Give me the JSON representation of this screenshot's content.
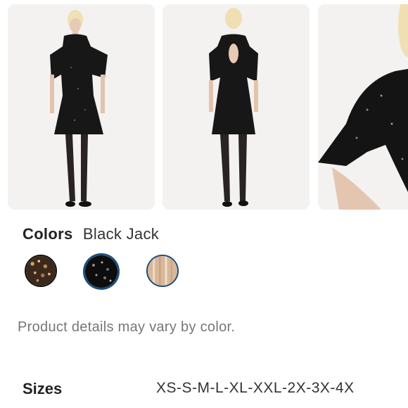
{
  "gallery": {
    "images": [
      {
        "icon": "dress-front-photo"
      },
      {
        "icon": "dress-back-photo"
      },
      {
        "icon": "dress-sleeve-closeup-photo"
      }
    ]
  },
  "colors": {
    "label": "Colors",
    "selected": "Black Jack",
    "swatches": [
      {
        "icon": "gold-sequin-swatch",
        "color": "#6b4a2e",
        "selected": false
      },
      {
        "icon": "black-sequin-swatch",
        "color": "#111111",
        "selected": true
      },
      {
        "icon": "champagne-sequin-swatch",
        "color": "#d9b89a",
        "selected": false
      }
    ]
  },
  "note": "Product details may vary by color.",
  "sizes": {
    "label": "Sizes",
    "value": "XS-S-M-L-XL-XXL-2X-3X-4X"
  }
}
